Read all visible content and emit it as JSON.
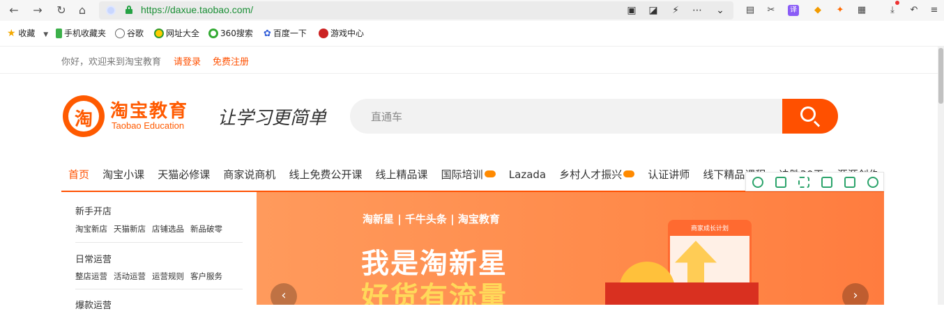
{
  "browser": {
    "url": "https://daxue.taobao.com/",
    "bookmarks": [
      {
        "label": "收藏",
        "icon": "star-icon",
        "color": "#f4a800"
      },
      {
        "label": "手机收藏夹",
        "icon": "phone-icon",
        "color": "#3cb04a"
      },
      {
        "label": "谷歌",
        "icon": "globe-icon",
        "color": "#666666"
      },
      {
        "label": "网址大全",
        "icon": "plus-circle-icon",
        "color": "#ffcc00"
      },
      {
        "label": "360搜索",
        "icon": "search-360-icon",
        "color": "#33aa33"
      },
      {
        "label": "百度一下",
        "icon": "paw-icon",
        "color": "#2f5cd8"
      },
      {
        "label": "游戏中心",
        "icon": "game-center-icon",
        "color": "#cc2222"
      }
    ]
  },
  "topbar": {
    "welcome": "你好，欢迎来到淘宝教育",
    "login": "请登录",
    "register": "免费注册"
  },
  "header": {
    "logo_char": "淘",
    "logo_cn": "淘宝教育",
    "logo_en": "Taobao Education",
    "slogan": "让学习更简单",
    "search_placeholder": "直通车"
  },
  "nav": {
    "items": [
      {
        "label": "首页",
        "active": true
      },
      {
        "label": "淘宝小课"
      },
      {
        "label": "天猫必修课"
      },
      {
        "label": "商家说商机"
      },
      {
        "label": "线上免费公开课"
      },
      {
        "label": "线上精品课"
      },
      {
        "label": "国际培训",
        "hot": true
      },
      {
        "label": "Lazada"
      },
      {
        "label": "乡村人才振兴",
        "hot": true
      },
      {
        "label": "认证讲师"
      },
      {
        "label": "线下精品课程"
      },
      {
        "label": "决胜30天"
      },
      {
        "label": "源源创作"
      }
    ]
  },
  "sidebar": {
    "sections": [
      {
        "title": "新手开店",
        "links": [
          "淘宝新店",
          "天猫新店",
          "店铺选品",
          "新品破零"
        ]
      },
      {
        "title": "日常运营",
        "links": [
          "整店运营",
          "活动运营",
          "运营规则",
          "客户服务"
        ]
      },
      {
        "title": "爆款运营",
        "links": []
      }
    ]
  },
  "banner": {
    "brand": "淘新星 | 千牛头条 | 淘宝教育",
    "brand_en": "Taobao Education",
    "title": "我是淘新星",
    "subtitle": "好货有流量",
    "card_label": "商家成长计划",
    "prev": "‹",
    "next": "›"
  },
  "colors": {
    "accent": "#ff5000",
    "url_green": "#1b8f36",
    "banner_bg": "#ff8a4a"
  }
}
